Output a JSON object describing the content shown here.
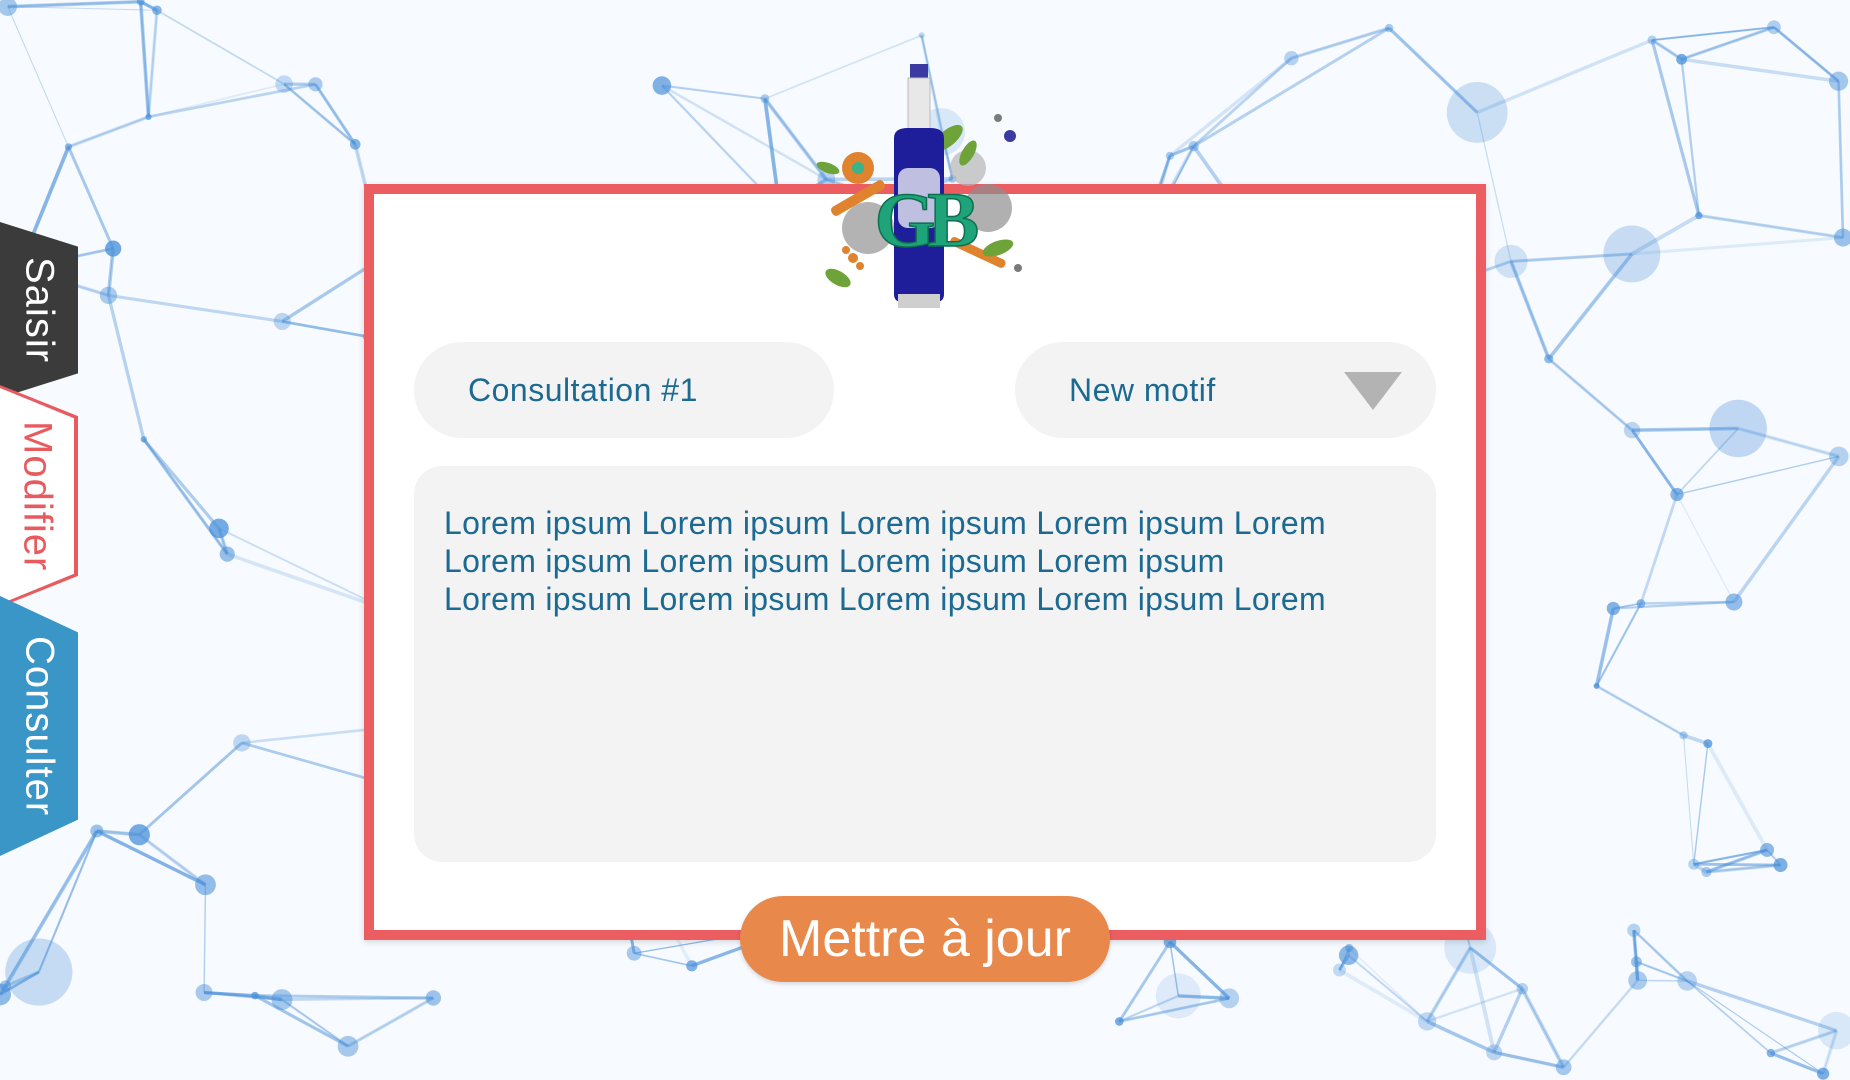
{
  "nav": {
    "tabs": [
      {
        "label": "Saisir",
        "state": "default",
        "color": "#3b3b3b"
      },
      {
        "label": "Modifier",
        "state": "active",
        "color": "#e85a5e"
      },
      {
        "label": "Consulter",
        "state": "default",
        "color": "#3996c6"
      }
    ]
  },
  "form": {
    "consultation_value": "Consultation #1",
    "motif_selected": "New motif",
    "notes_lines": [
      "Lorem ipsum Lorem ipsum Lorem ipsum Lorem ipsum Lorem",
      "Lorem ipsum Lorem ipsum Lorem ipsum Lorem ipsum",
      "Lorem ipsum Lorem ipsum Lorem ipsum Lorem ipsum Lorem"
    ],
    "submit_label": "Mettre à jour"
  },
  "logo": {
    "letters": "GB",
    "icon": "gin-bottle-botanical-logo"
  },
  "colors": {
    "accent_red": "#eb5d61",
    "accent_orange": "#e8884a",
    "text_blue": "#1c6a92",
    "logo_green": "#1fa47a",
    "network_blue": "#4a90d9"
  }
}
